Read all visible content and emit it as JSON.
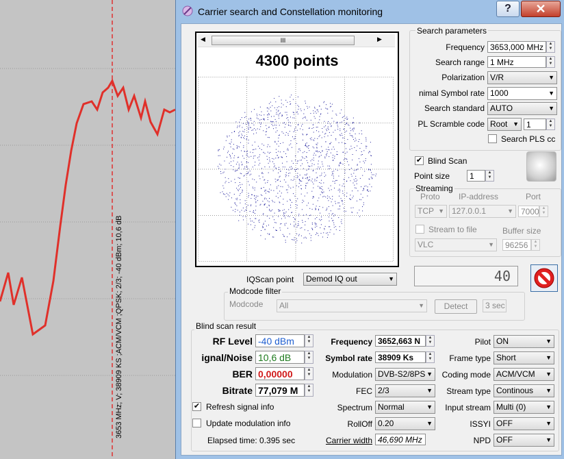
{
  "window": {
    "title": "Carrier search and Constellation monitoring",
    "help_label": "?",
    "close_label": "✕"
  },
  "spectrum": {
    "marker_text": "3653 MHz; V; 38909 KS ;ACM/VCM ;QPSK; 2/3; -40 dBm; 10,6 dB",
    "line_color": "#e0302a",
    "marker_color": "#e03030"
  },
  "constellation": {
    "title": "4300 points",
    "scroll_grip": "III"
  },
  "search_params": {
    "group_label": "Search parameters",
    "frequency_label": "Frequency",
    "frequency_value": "3653,000 MHz",
    "range_label": "Search range",
    "range_value": "1 MHz",
    "polarization_label": "Polarization",
    "polarization_value": "V/R",
    "symbol_rate_label": "nimal Symbol rate",
    "symbol_rate_value": "1000",
    "standard_label": "Search standard",
    "standard_value": "AUTO",
    "pl_scramble_label": "PL Scramble code",
    "pl_scramble_mode": "Root",
    "pl_scramble_value": "1",
    "search_pls_label": "Search PLS cc"
  },
  "blind_scan_opt": {
    "label": "Blind Scan",
    "point_size_label": "Point size",
    "point_size_value": "1"
  },
  "streaming": {
    "group_label": "Streaming",
    "proto_header": "Proto",
    "ip_header": "IP-address",
    "port_header": "Port",
    "proto_value": "TCP",
    "ip_value": "127.0.0.1",
    "port_value": "7000",
    "stream_to_file_label": "Stream to file",
    "buffer_size_label": "Buffer size",
    "player_value": "VLC",
    "buffer_size_value": "96256"
  },
  "counter": {
    "value": "40"
  },
  "iq": {
    "label": "IQScan point",
    "value": "Demod IQ out"
  },
  "modcode": {
    "group_label": "Modcode filter",
    "label": "Modcode",
    "value": "All",
    "detect_label": "Detect",
    "time_value": "3 sec"
  },
  "result": {
    "group_label": "Blind scan result",
    "rf_level_label": "RF Level",
    "rf_level_value": "-40 dBm",
    "snr_label": "ignal/Noise",
    "snr_value": "10,6 dB",
    "ber_label": "BER",
    "ber_value": "0,00000",
    "bitrate_label": "Bitrate",
    "bitrate_value": "77,079 M",
    "frequency_label": "Frequency",
    "frequency_value": "3652,663 N",
    "symbol_rate_label": "Symbol rate",
    "symbol_rate_value": "38909 Ks",
    "modulation_label": "Modulation",
    "modulation_value": "DVB-S2/8PS",
    "fec_label": "FEC",
    "fec_value": "2/3",
    "spectrum_label": "Spectrum",
    "spectrum_value": "Normal",
    "rolloff_label": "RollOff",
    "rolloff_value": "0.20",
    "carrier_width_label": "Carrier width",
    "carrier_width_value": "46,690 MHz",
    "pilot_label": "Pilot",
    "pilot_value": "ON",
    "frame_type_label": "Frame type",
    "frame_type_value": "Short",
    "coding_mode_label": "Coding mode",
    "coding_mode_value": "ACM/VCM",
    "stream_type_label": "Stream type",
    "stream_type_value": "Continous",
    "input_stream_label": "Input stream",
    "input_stream_value": "Multi (0)",
    "issyi_label": "ISSYI",
    "issyi_value": "OFF",
    "npd_label": "NPD",
    "npd_value": "OFF",
    "refresh_label": "Refresh signal info",
    "update_mod_label": "Update modulation info",
    "elapsed": "Elapsed time: 0.395 sec"
  },
  "colors": {
    "rf_level": "#1f5fd0",
    "snr": "#1d7a1d",
    "ber": "#d01818"
  }
}
